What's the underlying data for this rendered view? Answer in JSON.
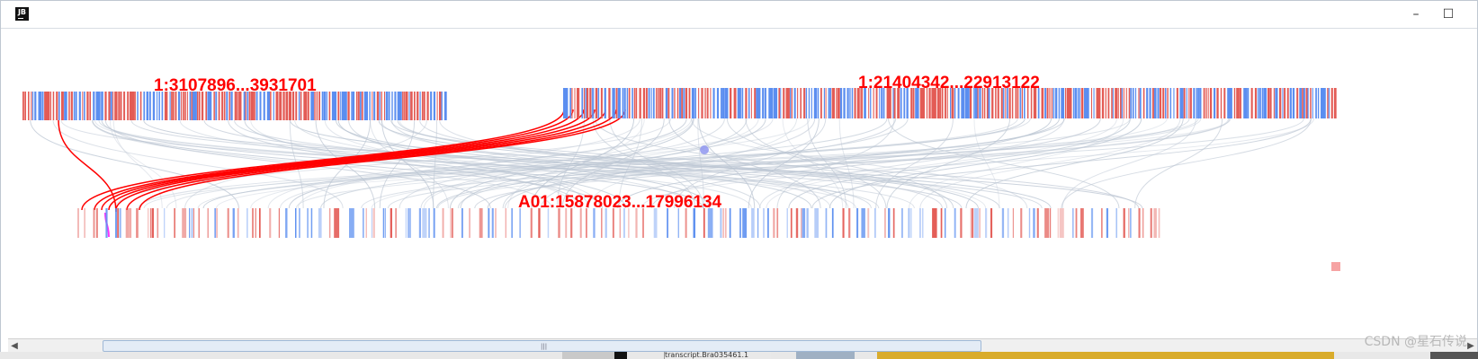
{
  "window": {
    "app_icon": "JB",
    "minimize_icon": "minimize-icon",
    "maximize_icon": "maximize-icon"
  },
  "colors": {
    "forward": "#e35b55",
    "reverse": "#5b8ef0",
    "highlight": "#ff0000",
    "link": "#bcc6d3",
    "magenta": "#ff00ff"
  },
  "tracks": [
    {
      "id": "top-left",
      "label": "1:3107896...3931701"
    },
    {
      "id": "top-right",
      "label": "1:21404342...22913122"
    },
    {
      "id": "bottom",
      "label": "A01:15878023...17996134"
    }
  ],
  "status": {
    "tab_text": "transcript.Bra035461.1"
  },
  "watermark": "CSDN @星石传说"
}
